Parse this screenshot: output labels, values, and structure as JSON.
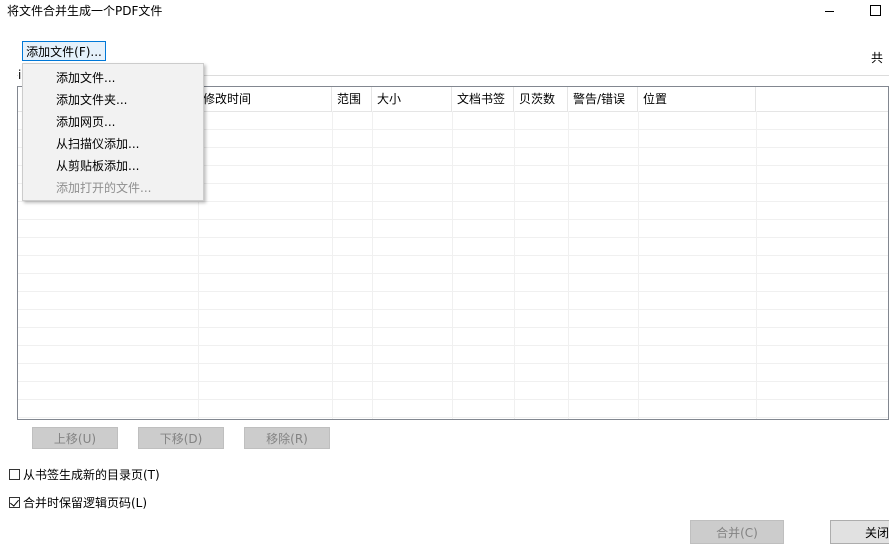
{
  "window": {
    "title": "将文件合并生成一个PDF文件"
  },
  "toolbar": {
    "add_button_label": "添加文件(F)...",
    "total_label": "共"
  },
  "group": {
    "caption_fragment": "i"
  },
  "table": {
    "columns": [
      "",
      "修改时间",
      "范围",
      "大小",
      "文档书签",
      "贝茨数",
      "警告/错误",
      "位置",
      ""
    ]
  },
  "menu": {
    "items": [
      {
        "label": "添加文件...",
        "enabled": true
      },
      {
        "label": "添加文件夹...",
        "enabled": true
      },
      {
        "label": "添加网页...",
        "enabled": true
      },
      {
        "label": "从扫描仪添加...",
        "enabled": true
      },
      {
        "label": "从剪贴板添加...",
        "enabled": true
      },
      {
        "label": "添加打开的文件...",
        "enabled": false
      }
    ]
  },
  "actions": {
    "move_up": "上移(U)",
    "move_down": "下移(D)",
    "remove": "移除(R)"
  },
  "options": {
    "gen_toc_label": "从书签生成新的目录页(T)",
    "gen_toc_checked": false,
    "keep_logical_label": "合并时保留逻辑页码(L)",
    "keep_logical_checked": true
  },
  "footer": {
    "merge_label": "合并(C)",
    "close_label": "关闭"
  },
  "colors": {
    "accent": "#0078d7",
    "disabled_text": "#838383"
  }
}
